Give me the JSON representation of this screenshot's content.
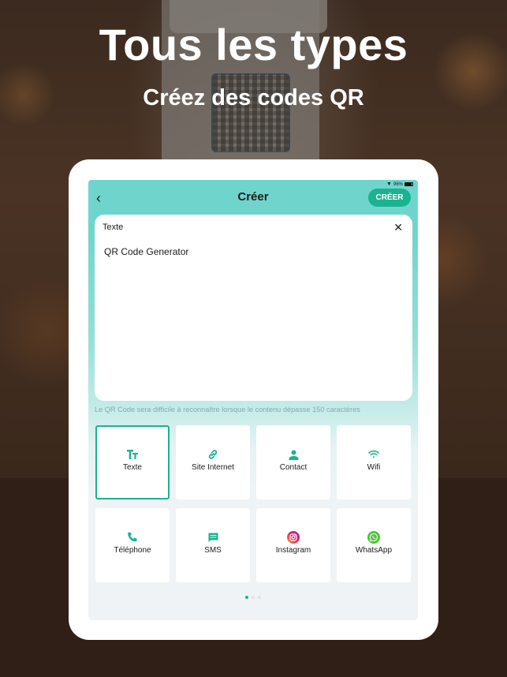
{
  "marketing": {
    "headline": "Tous les types",
    "subheadline": "Créez des codes QR"
  },
  "status_bar": {
    "battery": "96%",
    "wifi_icon": "wifi-icon",
    "battery_icon": "battery-icon"
  },
  "nav": {
    "back_icon": "chevron-left-icon",
    "title": "Créer",
    "create_button": "CRÉER"
  },
  "editor": {
    "label": "Texte",
    "close_icon": "close-icon",
    "value": "QR Code Generator"
  },
  "hint": "Le QR Code sera difficile à reconnaître lorsque le contenu dépasse 150 caractères",
  "types": [
    {
      "label": "Texte",
      "icon": "text-size-icon",
      "selected": true
    },
    {
      "label": "Site Internet",
      "icon": "link-icon",
      "selected": false
    },
    {
      "label": "Contact",
      "icon": "person-icon",
      "selected": false
    },
    {
      "label": "Wifi",
      "icon": "wifi-icon",
      "selected": false
    },
    {
      "label": "Téléphone",
      "icon": "phone-icon",
      "selected": false
    },
    {
      "label": "SMS",
      "icon": "message-icon",
      "selected": false
    },
    {
      "label": "Instagram",
      "icon": "instagram-icon",
      "selected": false
    },
    {
      "label": "WhatsApp",
      "icon": "whatsapp-icon",
      "selected": false
    }
  ],
  "pagination": {
    "pages": 3,
    "current": 1
  },
  "colors": {
    "accent": "#19b48f",
    "header_teal": "#6fd5cc",
    "background": "#2f1f16"
  }
}
